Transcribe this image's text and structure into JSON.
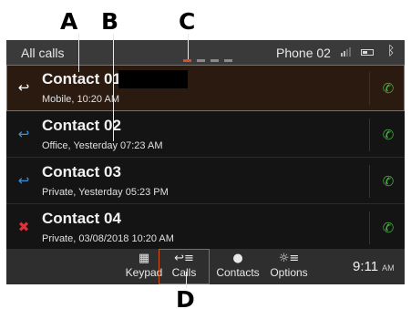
{
  "callouts": {
    "a": "A",
    "b": "B",
    "c": "C",
    "d": "D"
  },
  "status_bar": {
    "title": "All calls",
    "phone": "Phone 02",
    "signal_icon": "signal-icon",
    "battery_icon": "battery-icon",
    "bluetooth_icon": "bluetooth-icon",
    "bluetooth_glyph": "ᛒ"
  },
  "pager": {
    "pages": 4,
    "active_index": 0
  },
  "calls": [
    {
      "name": "Contact 01",
      "detail": "Mobile, 10:20 AM",
      "type": "outgoing",
      "glyph": "↩",
      "color": "#ffffff",
      "selected": true,
      "redacted": true
    },
    {
      "name": "Contact 02",
      "detail": "Office, Yesterday 07:23 AM",
      "type": "incoming",
      "glyph": "↩",
      "color": "#3f8fd8",
      "selected": false,
      "redacted": false
    },
    {
      "name": "Contact 03",
      "detail": "Private, Yesterday 05:23 PM",
      "type": "incoming",
      "glyph": "↩",
      "color": "#3f8fd8",
      "selected": false,
      "redacted": false
    },
    {
      "name": "Contact 04",
      "detail": "Private, 03/08/2018 10:20 AM",
      "type": "missed",
      "glyph": "✖",
      "color": "#e0303a",
      "selected": false,
      "redacted": false
    }
  ],
  "call_button": {
    "icon": "phone-icon",
    "glyph": "✆",
    "color": "#4bb043"
  },
  "navbar": {
    "items": [
      {
        "label": "Keypad",
        "icon": "keypad-icon",
        "glyph": "▦",
        "active": false
      },
      {
        "label": "Calls",
        "icon": "calls-icon",
        "glyph": "↩≡",
        "active": true
      },
      {
        "label": "Contacts",
        "icon": "contacts-icon",
        "glyph": "●",
        "active": false
      },
      {
        "label": "Options",
        "icon": "options-icon",
        "glyph": "☼≡",
        "active": false
      }
    ],
    "time": "9:11",
    "ampm": "AM"
  },
  "colors": {
    "accent": "#d0531c",
    "background": "#0c0c0c",
    "bar": "#3a3a3a"
  }
}
